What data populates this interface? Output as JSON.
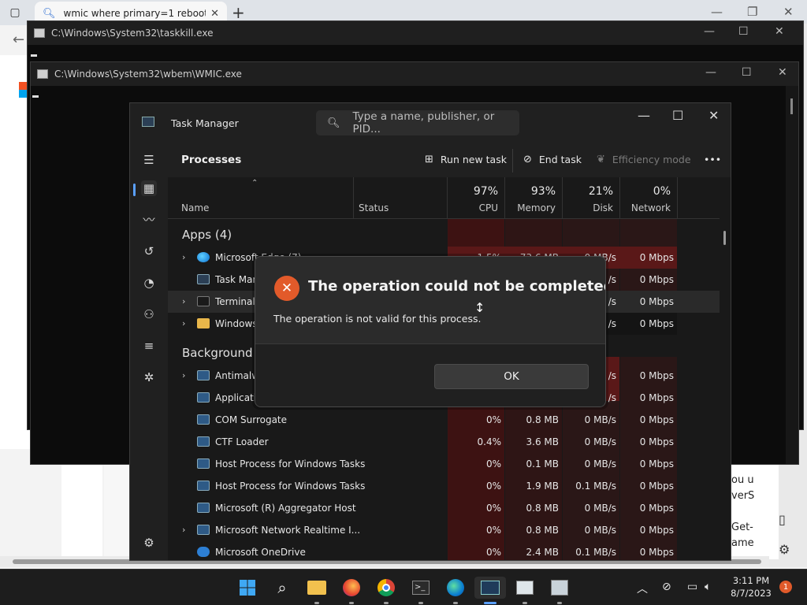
{
  "browser": {
    "tab_title": "wmic where primary=1 reboot -",
    "right_pane_lines": [
      "ou u",
      "verS",
      "",
      "Get-",
      "ame"
    ]
  },
  "cmd_windows": [
    {
      "title": "C:\\Windows\\System32\\taskkill.exe"
    },
    {
      "title": "C:\\Windows\\System32\\wbem\\WMIC.exe"
    }
  ],
  "task_manager": {
    "title": "Task Manager",
    "search_placeholder": "Type a name, publisher, or PID...",
    "heading": "Processes",
    "toolbar": {
      "run_new_task": "Run new task",
      "end_task": "End task",
      "efficiency_mode": "Efficiency mode",
      "more": "•••"
    },
    "columns": {
      "name": "Name",
      "status": "Status",
      "cpu": {
        "pct": "97%",
        "label": "CPU"
      },
      "memory": {
        "pct": "93%",
        "label": "Memory"
      },
      "disk": {
        "pct": "21%",
        "label": "Disk"
      },
      "network": {
        "pct": "0%",
        "label": "Network"
      }
    },
    "groups": {
      "apps": "Apps (4)",
      "background": "Background p"
    },
    "apps_rows": [
      {
        "name": "Microsoft Edge (7)",
        "cpu": "1.5%",
        "memory": "73.6 MB",
        "disk": "0 MB/s",
        "network": "0 Mbps"
      },
      {
        "name": "Task Manager",
        "cpu": "",
        "memory": "",
        "disk": "/s",
        "network": "0 Mbps"
      },
      {
        "name": "Terminal (",
        "cpu": "",
        "memory": "",
        "disk": "/s",
        "network": "0 Mbps"
      },
      {
        "name": "Windows",
        "cpu": "",
        "memory": "",
        "disk": "/s",
        "network": "0 Mbps"
      }
    ],
    "background_rows": [
      {
        "name": "Antimalw",
        "cpu": "",
        "memory": "",
        "disk": "/s",
        "network": "0 Mbps"
      },
      {
        "name": "Applicatio",
        "cpu": "",
        "memory": "",
        "disk": "/s",
        "network": "0 Mbps"
      },
      {
        "name": "COM Surrogate",
        "cpu": "0%",
        "memory": "0.8 MB",
        "disk": "0 MB/s",
        "network": "0 Mbps"
      },
      {
        "name": "CTF Loader",
        "cpu": "0.4%",
        "memory": "3.6 MB",
        "disk": "0 MB/s",
        "network": "0 Mbps"
      },
      {
        "name": "Host Process for Windows Tasks",
        "cpu": "0%",
        "memory": "0.1 MB",
        "disk": "0 MB/s",
        "network": "0 Mbps"
      },
      {
        "name": "Host Process for Windows Tasks",
        "cpu": "0%",
        "memory": "1.9 MB",
        "disk": "0.1 MB/s",
        "network": "0 Mbps"
      },
      {
        "name": "Microsoft (R) Aggregator Host",
        "cpu": "0%",
        "memory": "0.8 MB",
        "disk": "0 MB/s",
        "network": "0 Mbps"
      },
      {
        "name": "Microsoft Network Realtime I...",
        "cpu": "0%",
        "memory": "0.8 MB",
        "disk": "0 MB/s",
        "network": "0 Mbps"
      },
      {
        "name": "Microsoft OneDrive",
        "cpu": "0%",
        "memory": "2.4 MB",
        "disk": "0.1 MB/s",
        "network": "0 Mbps"
      }
    ]
  },
  "dialog": {
    "title": "The operation could not be completed.",
    "message": "The operation is not valid for this process.",
    "ok_label": "OK"
  },
  "taskbar": {
    "time": "3:11 PM",
    "date": "8/7/2023",
    "notification_count": "1"
  },
  "colors": {
    "accent": "#5aa0ff",
    "error": "#e25a2a",
    "heat_cpu": "#4a1414",
    "heat_mem": "#3a1616",
    "heat_disk_hot": "#5a1a1a"
  }
}
